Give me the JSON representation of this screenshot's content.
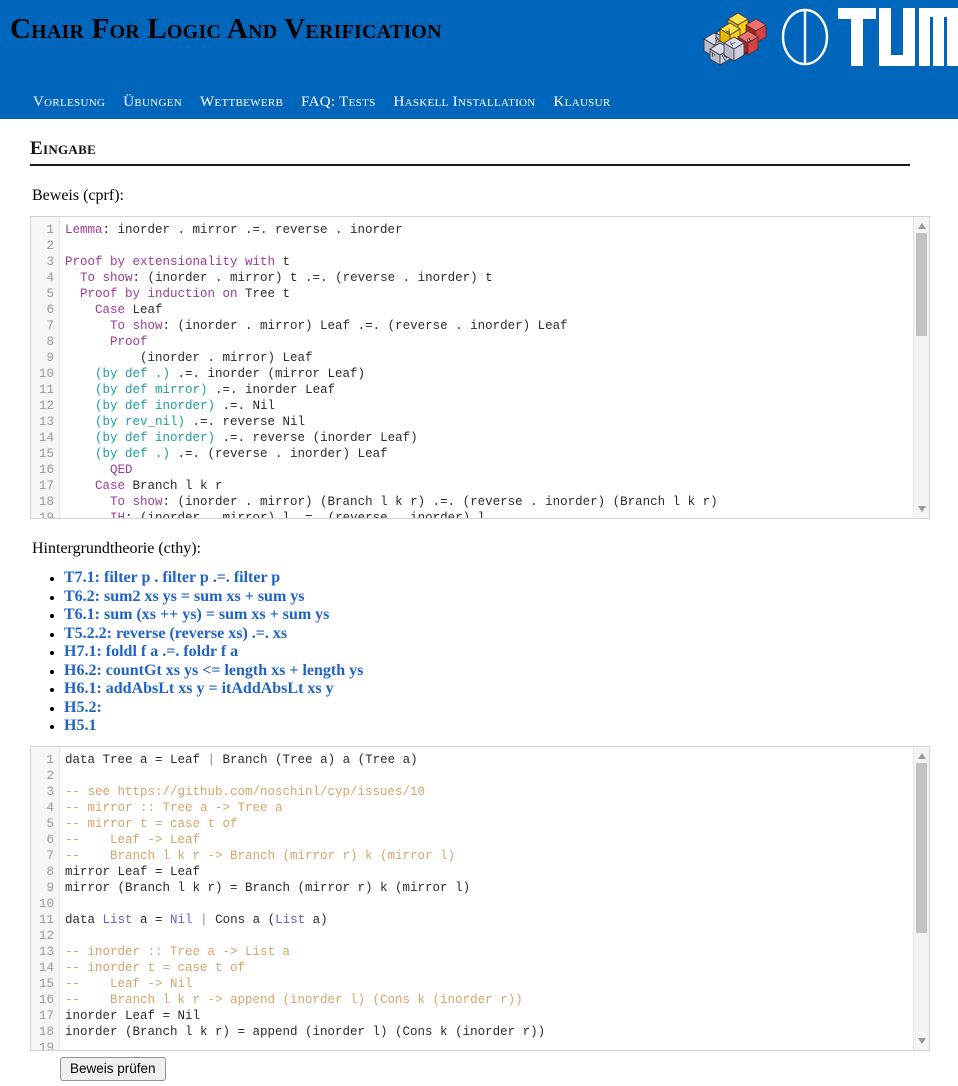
{
  "header": {
    "title": "Chair For Logic And Verification",
    "brand_blue": "#0066bc",
    "logo": {
      "cube_icon": "logic-cube-icon",
      "cube_symbols": [
        "∀",
        "∃",
        "⊢",
        "λ",
        "β",
        "α",
        "→"
      ],
      "circle_icon": "tum-circle-icon",
      "wordmark": "TUM"
    },
    "nav": [
      {
        "label": "Vorlesung",
        "name": "nav-item-vorlesung"
      },
      {
        "label": "Übungen",
        "name": "nav-item-uebungen"
      },
      {
        "label": "Wettbewerb",
        "name": "nav-item-wettbewerb"
      },
      {
        "label": "FAQ: Tests",
        "name": "nav-item-faq-tests"
      },
      {
        "label": "Haskell Installation",
        "name": "nav-item-haskell-installation"
      },
      {
        "label": "Klausur",
        "name": "nav-item-klausur"
      }
    ]
  },
  "main": {
    "section_heading": "Eingabe",
    "proof_label": "Beweis (cprf):",
    "theory_label": "Hintergrundtheorie (cthy):",
    "submit_label": "Beweis prüfen"
  },
  "proof_editor": {
    "name": "proof-code-editor",
    "line_numbers": [
      1,
      2,
      3,
      4,
      5,
      6,
      7,
      8,
      9,
      10,
      11,
      12,
      13,
      14,
      15,
      16,
      17,
      18,
      19
    ],
    "lines": [
      [
        {
          "t": "Lemma",
          "c": "kw"
        },
        {
          "t": ": inorder . mirror .=. reverse . inorder",
          "c": ""
        }
      ],
      [],
      [
        {
          "t": "Proof by extensionality with",
          "c": "kw"
        },
        {
          "t": " t",
          "c": ""
        }
      ],
      [
        {
          "t": "  ",
          "c": ""
        },
        {
          "t": "To show",
          "c": "kw"
        },
        {
          "t": ": (inorder . mirror) t .=. (reverse . inorder) t",
          "c": ""
        }
      ],
      [
        {
          "t": "  ",
          "c": ""
        },
        {
          "t": "Proof by induction on",
          "c": "kw"
        },
        {
          "t": " Tree t",
          "c": ""
        }
      ],
      [
        {
          "t": "    ",
          "c": ""
        },
        {
          "t": "Case",
          "c": "kw"
        },
        {
          "t": " Leaf",
          "c": ""
        }
      ],
      [
        {
          "t": "      ",
          "c": ""
        },
        {
          "t": "To show",
          "c": "kw"
        },
        {
          "t": ": (inorder . mirror) Leaf .=. (reverse . inorder) Leaf",
          "c": ""
        }
      ],
      [
        {
          "t": "      ",
          "c": ""
        },
        {
          "t": "Proof",
          "c": "kw"
        }
      ],
      [
        {
          "t": "          (inorder . mirror) Leaf",
          "c": ""
        }
      ],
      [
        {
          "t": "    ",
          "c": ""
        },
        {
          "t": "(by def .)",
          "c": "by"
        },
        {
          "t": " .=. inorder (mirror Leaf)",
          "c": ""
        }
      ],
      [
        {
          "t": "    ",
          "c": ""
        },
        {
          "t": "(by def mirror)",
          "c": "by"
        },
        {
          "t": " .=. inorder Leaf",
          "c": ""
        }
      ],
      [
        {
          "t": "    ",
          "c": ""
        },
        {
          "t": "(by def inorder)",
          "c": "by"
        },
        {
          "t": " .=. Nil",
          "c": ""
        }
      ],
      [
        {
          "t": "    ",
          "c": ""
        },
        {
          "t": "(by rev_nil)",
          "c": "by"
        },
        {
          "t": " .=. reverse Nil",
          "c": ""
        }
      ],
      [
        {
          "t": "    ",
          "c": ""
        },
        {
          "t": "(by def inorder)",
          "c": "by"
        },
        {
          "t": " .=. reverse (inorder Leaf)",
          "c": ""
        }
      ],
      [
        {
          "t": "    ",
          "c": ""
        },
        {
          "t": "(by def .)",
          "c": "by"
        },
        {
          "t": " .=. (reverse . inorder) Leaf",
          "c": ""
        }
      ],
      [
        {
          "t": "      ",
          "c": ""
        },
        {
          "t": "QED",
          "c": "kw"
        }
      ],
      [
        {
          "t": "    ",
          "c": ""
        },
        {
          "t": "Case",
          "c": "kw"
        },
        {
          "t": " Branch l k r",
          "c": ""
        }
      ],
      [
        {
          "t": "      ",
          "c": ""
        },
        {
          "t": "To show",
          "c": "kw"
        },
        {
          "t": ": (inorder . mirror) (Branch l k r) .=. (reverse . inorder) (Branch l k r)",
          "c": ""
        }
      ],
      [
        {
          "t": "      ",
          "c": ""
        },
        {
          "t": "IH",
          "c": "kw"
        },
        {
          "t": ": (inorder . mirror) l .=. (reverse . inorder) l",
          "c": ""
        }
      ]
    ]
  },
  "theory_list": {
    "name": "background-theory-list",
    "items": [
      "T7.1: filter p . filter p .=. filter p",
      "T6.2: sum2 xs ys = sum xs + sum ys",
      "T6.1: sum (xs ++ ys) = sum xs + sum ys",
      "T5.2.2: reverse (reverse xs) .=. xs",
      "H7.1: foldl f a .=. foldr f a",
      "H6.2: countGt xs ys <= length xs + length ys",
      "H6.1: addAbsLt xs y = itAddAbsLt xs y",
      "H5.2:",
      "H5.1"
    ]
  },
  "theory_editor": {
    "name": "theory-code-editor",
    "line_numbers": [
      1,
      2,
      3,
      4,
      5,
      6,
      7,
      8,
      9,
      10,
      11,
      12,
      13,
      14,
      15,
      16,
      17,
      18,
      19
    ],
    "lines": [
      [
        {
          "t": "data Tree a = Leaf ",
          "c": ""
        },
        {
          "t": "|",
          "c": "pipe"
        },
        {
          "t": " Branch (Tree a) a (Tree a)",
          "c": ""
        }
      ],
      [],
      [
        {
          "t": "-- see https://github.com/noschinl/cyp/issues/10",
          "c": "cmt"
        }
      ],
      [
        {
          "t": "-- mirror :: Tree a -> Tree a",
          "c": "cmt"
        }
      ],
      [
        {
          "t": "-- mirror t = case t of",
          "c": "cmt"
        }
      ],
      [
        {
          "t": "--    Leaf -> Leaf",
          "c": "cmt"
        }
      ],
      [
        {
          "t": "--    Branch l k r -> Branch (mirror r) k (mirror l)",
          "c": "cmt"
        }
      ],
      [
        {
          "t": "mirror Leaf = Leaf",
          "c": ""
        }
      ],
      [
        {
          "t": "mirror (Branch l k r) = Branch (mirror r) k (mirror l)",
          "c": ""
        }
      ],
      [],
      [
        {
          "t": "data ",
          "c": ""
        },
        {
          "t": "List",
          "c": "typ"
        },
        {
          "t": " a = ",
          "c": ""
        },
        {
          "t": "Nil",
          "c": "typ"
        },
        {
          "t": " ",
          "c": ""
        },
        {
          "t": "|",
          "c": "pipe"
        },
        {
          "t": " Cons a (",
          "c": ""
        },
        {
          "t": "List",
          "c": "typ"
        },
        {
          "t": " a)",
          "c": ""
        }
      ],
      [],
      [
        {
          "t": "-- inorder :: Tree a -> List a",
          "c": "cmt"
        }
      ],
      [
        {
          "t": "-- inorder t = case t of",
          "c": "cmt"
        }
      ],
      [
        {
          "t": "--    Leaf -> Nil",
          "c": "cmt"
        }
      ],
      [
        {
          "t": "--    Branch l k r -> append (inorder l) (Cons k (inorder r))",
          "c": "cmt"
        }
      ],
      [
        {
          "t": "inorder Leaf = Nil",
          "c": ""
        }
      ],
      [
        {
          "t": "inorder (Branch l k r) = append (inorder l) (Cons k (inorder r))",
          "c": ""
        }
      ],
      []
    ]
  }
}
